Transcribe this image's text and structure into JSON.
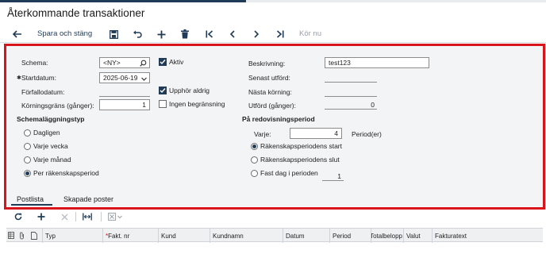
{
  "app": {
    "title": "Återkommande transaktioner"
  },
  "toolbar": {
    "save_close_label": "Spara och stäng",
    "run_now_label": "Kör nu"
  },
  "form": {
    "schema": {
      "label": "Schema:",
      "value": "<NY>"
    },
    "aktiv": {
      "label": "Aktiv",
      "checked": true
    },
    "startdatum": {
      "label": "Startdatum:",
      "value": "2025-06-19"
    },
    "forfallodatum": {
      "label": "Förfallodatum:"
    },
    "upphor_aldrig": {
      "label": "Upphör aldrig",
      "checked": true
    },
    "korningsgrans": {
      "label": "Körningsgräns (gånger):",
      "value": "1"
    },
    "ingen_begransning": {
      "label": "Ingen begränsning",
      "checked": false
    },
    "beskrivning": {
      "label": "Beskrivning:",
      "value": "test123"
    },
    "senast_utford": {
      "label": "Senast utförd:",
      "value": ""
    },
    "nasta_korning": {
      "label": "Nästa körning:",
      "value": ""
    },
    "utford_ganger": {
      "label": "Utförd (gånger):",
      "value": "0"
    }
  },
  "schedule_type": {
    "heading": "Schemaläggningstyp",
    "options": [
      {
        "label": "Dagligen",
        "selected": false
      },
      {
        "label": "Varje vecka",
        "selected": false
      },
      {
        "label": "Varje månad",
        "selected": false
      },
      {
        "label": "Per räkenskapsperiod",
        "selected": true
      }
    ]
  },
  "period": {
    "heading": "På redovisningsperiod",
    "every_label": "Varje:",
    "every_value": "4",
    "unit_label": "Period(er)",
    "options": [
      {
        "label": "Räkenskapsperiodens start",
        "selected": true
      },
      {
        "label": "Räkenskapsperiodens slut",
        "selected": false
      },
      {
        "label": "Fast dag i perioden",
        "selected": false
      }
    ],
    "fixed_day_value": "1"
  },
  "tabs": [
    {
      "label": "Postlista",
      "active": true
    },
    {
      "label": "Skapade poster",
      "active": false
    }
  ],
  "grid": {
    "required_marker": "*",
    "columns": [
      "Typ",
      "Fakt. nr",
      "Kund",
      "Kundnamn",
      "Datum",
      "Period",
      "Totalbelopp",
      "Valut",
      "Fakturatext"
    ]
  },
  "colors": {
    "accent": "#1f3b57",
    "highlight_border": "#d9151b",
    "panel_bg": "#f2f4f6"
  },
  "icons": [
    "back-arrow-icon",
    "save-icon",
    "undo-icon",
    "add-icon",
    "delete-icon",
    "first-record-icon",
    "previous-record-icon",
    "next-record-icon",
    "last-record-icon",
    "search-icon",
    "chevron-down-icon",
    "refresh-icon",
    "fit-columns-icon",
    "excel-export-icon"
  ]
}
